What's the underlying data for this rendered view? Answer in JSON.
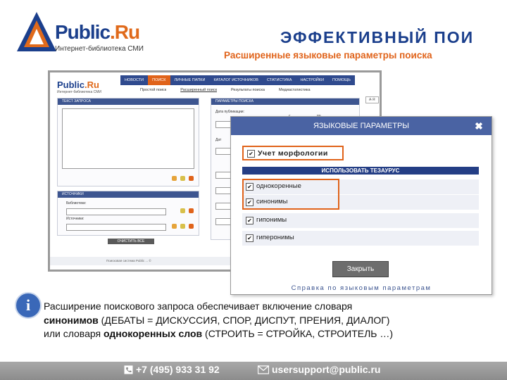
{
  "header": {
    "logo_main": "Public",
    "logo_ru": ".Ru",
    "logo_tagline": "Интернет-библиотека СМИ",
    "title": "ЭФФЕКТИВНЫЙ ПОИ",
    "subtitle": "Расширенные языковые параметры поиска"
  },
  "screenshot": {
    "logo_main": "Public",
    "logo_ru": ".Ru",
    "logo_tagline": "Интернет-библиотека СМИ",
    "nav": [
      "НОВОСТИ",
      "ПОИСК",
      "ЛИЧНЫЕ ПАПКИ",
      "КАТАЛОГ ИСТОЧНИКОВ",
      "СТАТИСТИКА",
      "НАСТРОЙКИ",
      "ПОМОЩЬ"
    ],
    "nav_active": 1,
    "subnav": [
      "Простой поиск",
      "Расширенный поиск",
      "Результаты поиска",
      "Медиастатистика"
    ],
    "aa": "А-Я",
    "panel_query": "ТЕКСТ ЗАПРОСА",
    "panel_params": "ПАРАМЕТРЫ ПОИСКА",
    "pub_date": "Дата публикации:",
    "from": "с",
    "to": "по",
    "date_label": "Дат",
    "panel_sources": "ИСТОЧНИКИ",
    "sources_opt1": "Библиотеки:",
    "sources_opt2": "Источники:",
    "sources_btn": "ОЧИСТИТЬ ВСЕ",
    "footer_text": "Поисковая система Public ... ©"
  },
  "dialog": {
    "title": "ЯЗЫКОВЫЕ ПАРАМЕТРЫ",
    "close_icon": "✖",
    "morphology": "Учет морфологии",
    "thesaurus": "ИСПОЛЬЗОВАТЬ ТЕЗАУРУС",
    "options": [
      "однокоренные",
      "синонимы",
      "гипонимы",
      "гиперонимы"
    ],
    "check_mark": "✔",
    "close_button": "Закрыть",
    "help_link": "Справка по языковым параметрам"
  },
  "info": {
    "icon": "i",
    "line1": "Расширение поискового запроса обеспечивает включение словаря",
    "line2_bold": "синонимов",
    "line2_rest": " (ДЕБАТЫ = ДИСКУССИЯ, СПОР, ДИСПУТ, ПРЕНИЯ, ДИАЛОГ)",
    "line3_start": "или словаря ",
    "line3_bold": "однокоренных слов",
    "line3_rest": "  (СТРОИТЬ =  СТРОЙКА, СТРОИТЕЛЬ …)"
  },
  "footer": {
    "phone": "+7 (495) 933 31 92",
    "email": "usersupport@public.ru",
    "phone_icon": "phone-icon",
    "mail_icon": "mail-icon"
  },
  "colors": {
    "brand_blue": "#1b3f8c",
    "accent_orange": "#e0631a",
    "dialog_header": "#4a63a3"
  }
}
